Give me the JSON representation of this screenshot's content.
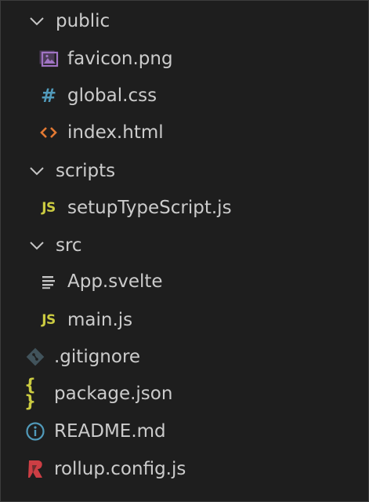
{
  "explorer": {
    "items": [
      {
        "label": "public",
        "icon": "chevron-down-icon",
        "kind": "folder",
        "level": 0
      },
      {
        "label": "favicon.png",
        "icon": "image-icon",
        "kind": "file",
        "level": 1
      },
      {
        "label": "global.css",
        "icon": "css-icon",
        "kind": "file",
        "level": 1
      },
      {
        "label": "index.html",
        "icon": "html-icon",
        "kind": "file",
        "level": 1
      },
      {
        "label": "scripts",
        "icon": "chevron-down-icon",
        "kind": "folder",
        "level": 0
      },
      {
        "label": "setupTypeScript.js",
        "icon": "javascript-icon",
        "kind": "file",
        "level": 1
      },
      {
        "label": "src",
        "icon": "chevron-down-icon",
        "kind": "folder",
        "level": 0
      },
      {
        "label": "App.svelte",
        "icon": "text-lines-icon",
        "kind": "file",
        "level": 1
      },
      {
        "label": "main.js",
        "icon": "javascript-icon",
        "kind": "file",
        "level": 1
      },
      {
        "label": ".gitignore",
        "icon": "git-icon",
        "kind": "file",
        "level": 0
      },
      {
        "label": "package.json",
        "icon": "json-icon",
        "kind": "file",
        "level": 0
      },
      {
        "label": "README.md",
        "icon": "info-icon",
        "kind": "file",
        "level": 0
      },
      {
        "label": "rollup.config.js",
        "icon": "rollup-icon",
        "kind": "file",
        "level": 0
      }
    ],
    "icon_glyphs": {
      "css": "#",
      "javascript": "JS",
      "json": "{ }"
    },
    "colors": {
      "background": "#1e1e1e",
      "text": "#cccccc",
      "chevron": "#c5c5c5",
      "image_icon": "#a074c4",
      "css_icon": "#519aba",
      "html_icon": "#e37933",
      "js_icon": "#cbcb41",
      "git_icon": "#41535b",
      "info_icon": "#519aba",
      "rollup_icon": "#cc3e44"
    }
  }
}
